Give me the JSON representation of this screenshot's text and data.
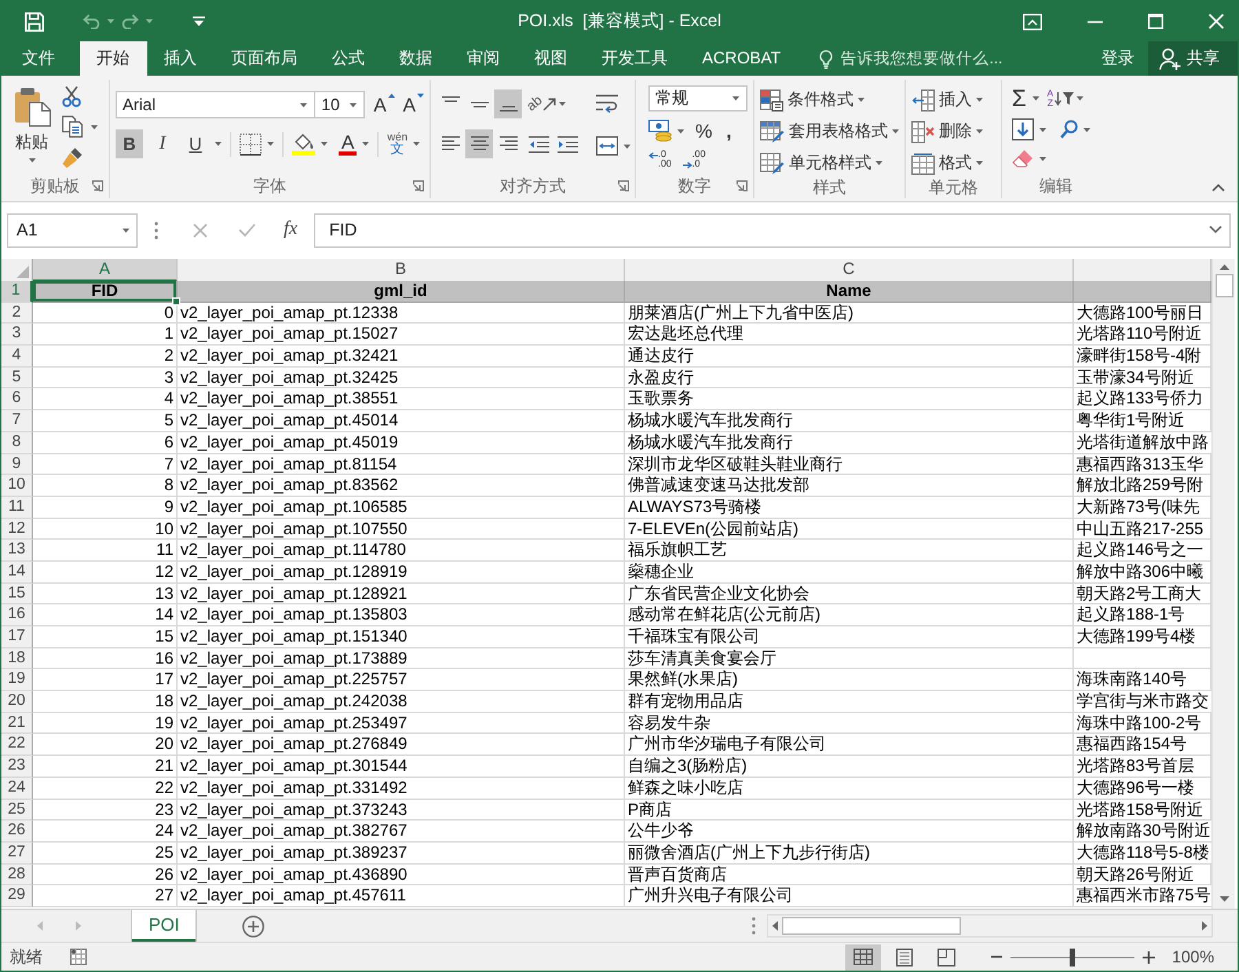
{
  "window": {
    "title": "POI.xls  [兼容模式] - Excel"
  },
  "quick_access": [
    {
      "kind": "save",
      "disabled": false
    },
    {
      "kind": "undo",
      "disabled": true
    },
    {
      "kind": "redo",
      "disabled": true
    },
    {
      "kind": "customize",
      "disabled": false
    }
  ],
  "ribbon_tabs": [
    {
      "label": "文件",
      "selected": false
    },
    {
      "label": "开始",
      "selected": true
    },
    {
      "label": "插入",
      "selected": false
    },
    {
      "label": "页面布局",
      "selected": false
    },
    {
      "label": "公式",
      "selected": false
    },
    {
      "label": "数据",
      "selected": false
    },
    {
      "label": "审阅",
      "selected": false
    },
    {
      "label": "视图",
      "selected": false
    },
    {
      "label": "开发工具",
      "selected": false
    },
    {
      "label": "ACROBAT",
      "selected": false
    }
  ],
  "tell_me": {
    "placeholder": "告诉我您想要做什么..."
  },
  "account": {
    "sign_in": "登录",
    "share": "共享"
  },
  "ribbon": {
    "clipboard": {
      "label": "剪贴板",
      "paste": "粘贴"
    },
    "font": {
      "label": "字体",
      "name": "Arial",
      "size": "10",
      "size_buttons": [
        {
          "kind": "grow",
          "glyph": "A"
        },
        {
          "kind": "shrink",
          "glyph": "A"
        }
      ],
      "styles": [
        {
          "kind": "bold",
          "glyph": "B",
          "selected": true
        },
        {
          "kind": "italic",
          "glyph": "I",
          "selected": false
        },
        {
          "kind": "underline",
          "glyph": "U",
          "selected": false
        }
      ],
      "font_color_glyph": "A",
      "phonetic": {
        "reading": "wén",
        "char": "文"
      }
    },
    "alignment": {
      "label": "对齐方式",
      "vertical": [
        {
          "kind": "top",
          "selected": false
        },
        {
          "kind": "middle",
          "selected": false
        },
        {
          "kind": "bottom",
          "selected": true
        }
      ],
      "orientation_glyph": "ab",
      "horizontal": [
        {
          "kind": "left",
          "selected": false
        },
        {
          "kind": "center",
          "selected": true
        },
        {
          "kind": "right",
          "selected": false
        }
      ]
    },
    "number": {
      "label": "数字",
      "format": "常规",
      "percent": "%",
      "comma": ",",
      "decimals": [
        {
          "kind": "increase",
          "lines": [
            ".0",
            ".00"
          ]
        },
        {
          "kind": "decrease",
          "lines": [
            ".00",
            ".0"
          ]
        }
      ]
    },
    "styles": {
      "label": "样式",
      "items": [
        {
          "kind": "conditional",
          "label": "条件格式"
        },
        {
          "kind": "table",
          "label": "套用表格格式"
        },
        {
          "kind": "cell_styles",
          "label": "单元格样式"
        }
      ]
    },
    "cells": {
      "label": "单元格",
      "items": [
        {
          "kind": "insert",
          "label": "插入"
        },
        {
          "kind": "delete",
          "label": "删除"
        },
        {
          "kind": "format",
          "label": "格式"
        }
      ]
    },
    "editing": {
      "label": "编辑",
      "autosum": "Σ",
      "sort_glyph": [
        "A",
        "Z"
      ]
    }
  },
  "formula_bar": {
    "name_box": "A1",
    "function_glyph": "fx",
    "content": "FID"
  },
  "sheet": {
    "columns": [
      {
        "label": "A",
        "numeric": true,
        "selected": true
      },
      {
        "label": "B",
        "numeric": false,
        "selected": false
      },
      {
        "label": "C",
        "numeric": false,
        "selected": false
      },
      {
        "numeric": false,
        "selected": false
      }
    ],
    "rows": [
      {
        "number": "1",
        "kind": "header",
        "selected": true,
        "cells": [
          "FID",
          "gml_id",
          "Name"
        ]
      },
      {
        "number": "2",
        "kind": "data",
        "selected": false,
        "cells": [
          "0",
          "v2_layer_poi_amap_pt.12338",
          "朋莱酒店(广州上下九省中医店)",
          "大德路100号丽日"
        ]
      },
      {
        "number": "3",
        "kind": "data",
        "selected": false,
        "cells": [
          "1",
          "v2_layer_poi_amap_pt.15027",
          "宏达匙坯总代理",
          "光塔路110号附近"
        ]
      },
      {
        "number": "4",
        "kind": "data",
        "selected": false,
        "cells": [
          "2",
          "v2_layer_poi_amap_pt.32421",
          "通达皮行",
          "濠畔街158号-4附"
        ]
      },
      {
        "number": "5",
        "kind": "data",
        "selected": false,
        "cells": [
          "3",
          "v2_layer_poi_amap_pt.32425",
          "永盈皮行",
          "玉带濠34号附近"
        ]
      },
      {
        "number": "6",
        "kind": "data",
        "selected": false,
        "cells": [
          "4",
          "v2_layer_poi_amap_pt.38551",
          "玉歌票务",
          "起义路133号侨力"
        ]
      },
      {
        "number": "7",
        "kind": "data",
        "selected": false,
        "cells": [
          "5",
          "v2_layer_poi_amap_pt.45014",
          "杨城水暖汽车批发商行",
          "粤华街1号附近"
        ]
      },
      {
        "number": "8",
        "kind": "data",
        "selected": false,
        "cells": [
          "6",
          "v2_layer_poi_amap_pt.45019",
          "杨城水暖汽车批发商行",
          "光塔街道解放中路"
        ]
      },
      {
        "number": "9",
        "kind": "data",
        "selected": false,
        "cells": [
          "7",
          "v2_layer_poi_amap_pt.81154",
          "深圳市龙华区破鞋头鞋业商行",
          "惠福西路313玉华"
        ]
      },
      {
        "number": "10",
        "kind": "data",
        "selected": false,
        "cells": [
          "8",
          "v2_layer_poi_amap_pt.83562",
          "佛普减速变速马达批发部",
          "解放北路259号附"
        ]
      },
      {
        "number": "11",
        "kind": "data",
        "selected": false,
        "cells": [
          "9",
          "v2_layer_poi_amap_pt.106585",
          "ALWAYS73号骑楼",
          "大新路73号(味先"
        ]
      },
      {
        "number": "12",
        "kind": "data",
        "selected": false,
        "cells": [
          "10",
          "v2_layer_poi_amap_pt.107550",
          "7-ELEVEn(公园前站店)",
          "中山五路217-255"
        ]
      },
      {
        "number": "13",
        "kind": "data",
        "selected": false,
        "cells": [
          "11",
          "v2_layer_poi_amap_pt.114780",
          "福乐旗帜工艺",
          "起义路146号之一"
        ]
      },
      {
        "number": "14",
        "kind": "data",
        "selected": false,
        "cells": [
          "12",
          "v2_layer_poi_amap_pt.128919",
          "燊穗企业",
          "解放中路306中曦"
        ]
      },
      {
        "number": "15",
        "kind": "data",
        "selected": false,
        "cells": [
          "13",
          "v2_layer_poi_amap_pt.128921",
          "广东省民营企业文化协会",
          "朝天路2号工商大"
        ]
      },
      {
        "number": "16",
        "kind": "data",
        "selected": false,
        "cells": [
          "14",
          "v2_layer_poi_amap_pt.135803",
          "感动常在鲜花店(公元前店)",
          "起义路188-1号"
        ]
      },
      {
        "number": "17",
        "kind": "data",
        "selected": false,
        "cells": [
          "15",
          "v2_layer_poi_amap_pt.151340",
          "千福珠宝有限公司",
          "大德路199号4楼"
        ]
      },
      {
        "number": "18",
        "kind": "data",
        "selected": false,
        "cells": [
          "16",
          "v2_layer_poi_amap_pt.173889",
          "莎车清真美食宴会厅"
        ]
      },
      {
        "number": "19",
        "kind": "data",
        "selected": false,
        "cells": [
          "17",
          "v2_layer_poi_amap_pt.225757",
          "果然鲜(水果店)",
          "海珠南路140号"
        ]
      },
      {
        "number": "20",
        "kind": "data",
        "selected": false,
        "cells": [
          "18",
          "v2_layer_poi_amap_pt.242038",
          "群有宠物用品店",
          "学宫街与米市路交"
        ]
      },
      {
        "number": "21",
        "kind": "data",
        "selected": false,
        "cells": [
          "19",
          "v2_layer_poi_amap_pt.253497",
          "容易发牛杂",
          "海珠中路100-2号"
        ]
      },
      {
        "number": "22",
        "kind": "data",
        "selected": false,
        "cells": [
          "20",
          "v2_layer_poi_amap_pt.276849",
          "广州市华汐瑞电子有限公司",
          "惠福西路154号"
        ]
      },
      {
        "number": "23",
        "kind": "data",
        "selected": false,
        "cells": [
          "21",
          "v2_layer_poi_amap_pt.301544",
          "自编之3(肠粉店)",
          "光塔路83号首层"
        ]
      },
      {
        "number": "24",
        "kind": "data",
        "selected": false,
        "cells": [
          "22",
          "v2_layer_poi_amap_pt.331492",
          "鲜森之味小吃店",
          "大德路96号一楼"
        ]
      },
      {
        "number": "25",
        "kind": "data",
        "selected": false,
        "cells": [
          "23",
          "v2_layer_poi_amap_pt.373243",
          "P商店",
          "光塔路158号附近"
        ]
      },
      {
        "number": "26",
        "kind": "data",
        "selected": false,
        "cells": [
          "24",
          "v2_layer_poi_amap_pt.382767",
          "公牛少爷",
          "解放南路30号附近"
        ]
      },
      {
        "number": "27",
        "kind": "data",
        "selected": false,
        "cells": [
          "25",
          "v2_layer_poi_amap_pt.389237",
          "丽微舍酒店(广州上下九步行街店)",
          "大德路118号5-8楼"
        ]
      },
      {
        "number": "28",
        "kind": "data",
        "selected": false,
        "cells": [
          "26",
          "v2_layer_poi_amap_pt.436890",
          "晋声百货商店",
          "朝天路26号附近"
        ]
      },
      {
        "number": "29",
        "kind": "data",
        "selected": false,
        "cells": [
          "27",
          "v2_layer_poi_amap_pt.457611",
          "广州升兴电子有限公司",
          "惠福西米市路75号"
        ]
      }
    ]
  },
  "sheet_tabs": [
    {
      "label": "POI",
      "selected": true
    }
  ],
  "status_bar": {
    "text": "就绪",
    "views": [
      {
        "kind": "normal",
        "selected": true
      },
      {
        "kind": "page_layout",
        "selected": false
      },
      {
        "kind": "page_break",
        "selected": false
      }
    ],
    "zoom": {
      "level": 0.5,
      "reading": "100%"
    }
  }
}
